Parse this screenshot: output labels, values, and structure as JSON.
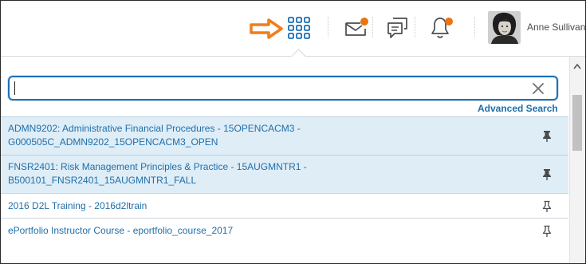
{
  "navbar": {
    "icons": {
      "arrow": "orange-arrow-pointer",
      "grid": "course-selector-grid-icon",
      "mail": "mail-icon",
      "chat": "chat-icon",
      "bell": "notification-bell-icon"
    },
    "user_name": "Anne Sullivan"
  },
  "course_selector": {
    "search": {
      "value": "",
      "placeholder": ""
    },
    "advanced_search_label": "Advanced Search",
    "courses": [
      {
        "line1": "ADMN9202: Administrative Financial Procedures - 15OPENCACM3 -",
        "line2": "G000505C_ADMN9202_15OPENCACM3_OPEN",
        "pinned": true
      },
      {
        "line1": "FNSR2401: Risk Management Principles & Practice - 15AUGMNTR1 -",
        "line2": "B500101_FNSR2401_15AUGMNTR1_FALL",
        "pinned": true
      },
      {
        "line1": "2016 D2L Training - 2016d2ltrain",
        "line2": "",
        "pinned": false
      },
      {
        "line1": "ePortfolio Instructor Course - eportfolio_course_2017",
        "line2": "",
        "pinned": false
      }
    ]
  },
  "colors": {
    "accent": "#1f6fa8",
    "focus_border": "#1e6fb3",
    "pinned_row_bg": "#dfedf7",
    "notification_dot": "#e87511",
    "arrow": "#f07d1b",
    "grid_icon": "#1b6db5"
  }
}
